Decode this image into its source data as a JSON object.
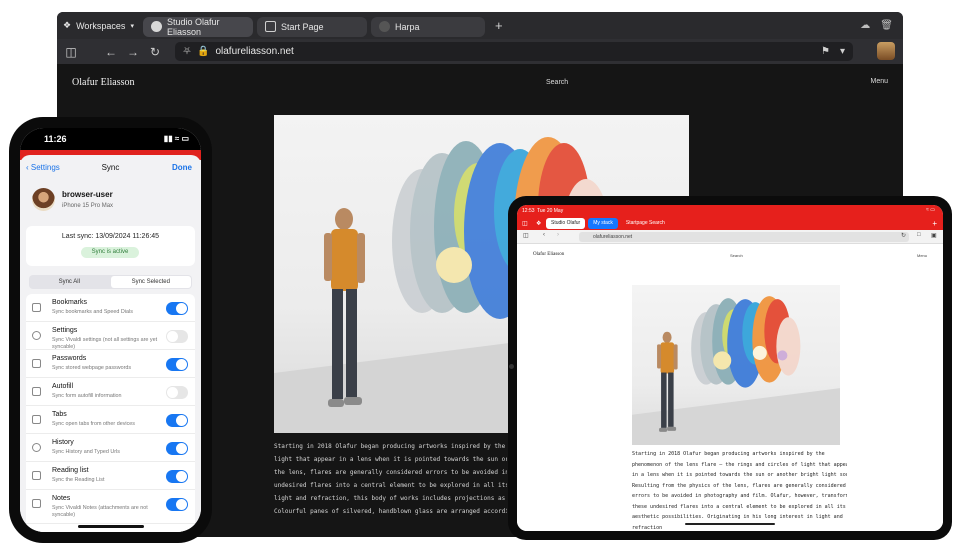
{
  "desktop": {
    "workspaces_label": "Workspaces",
    "tabs": [
      {
        "label": "Studio Olafur Eliasson"
      },
      {
        "label": "Start Page"
      },
      {
        "label": "Harpa"
      }
    ],
    "url": "olafureliasson.net",
    "site": {
      "logo": "Olafur Eliasson",
      "search": "Search",
      "menu": "Menu",
      "article_lines": [
        "Starting in 2018 Olafur began producing artworks inspired by the pho",
        "light that appear in a lens when it is pointed towards the sun or anot",
        "the lens, flares are generally considered errors to be avoided in phot",
        "undesired flares into a central element to be explored in all its aesth",
        "light and refraction, this body of works includes projections as well a",
        "Colourful panes of silvered, handblown glass are arranged according"
      ]
    }
  },
  "phone": {
    "time": "11:26",
    "back_label": "Settings",
    "title": "Sync",
    "done_label": "Done",
    "user_name": "browser-user",
    "device": "iPhone 15 Pro Max",
    "last_sync": "Last sync: 13/09/2024 11:26:45",
    "sync_status": "Sync is active",
    "segments": [
      "Sync All",
      "Sync Selected"
    ],
    "items": [
      {
        "label": "Bookmarks",
        "desc": "Sync bookmarks and Speed Dials",
        "on": true
      },
      {
        "label": "Settings",
        "desc": "Sync Vivaldi settings (not all settings are yet syncable)",
        "on": false
      },
      {
        "label": "Passwords",
        "desc": "Sync stored webpage passwords",
        "on": true
      },
      {
        "label": "Autofill",
        "desc": "Sync form autofill information",
        "on": false
      },
      {
        "label": "Tabs",
        "desc": "Sync open tabs from other devices",
        "on": true
      },
      {
        "label": "History",
        "desc": "Sync History and Typed Urls",
        "on": true
      },
      {
        "label": "Reading list",
        "desc": "Sync the Reading List",
        "on": true
      },
      {
        "label": "Notes",
        "desc": "Sync Vivaldi Notes (attachments are not syncable)",
        "on": true
      }
    ]
  },
  "tablet": {
    "time": "12:53",
    "date": "Tue 20 May",
    "tabs": [
      {
        "label": "Studio Olafur",
        "kind": "active"
      },
      {
        "label": "My stack",
        "kind": "stack"
      },
      {
        "label": "Startpage Search",
        "kind": "normal"
      }
    ],
    "url": "olafureliasson.net",
    "site": {
      "logo": "Olafur Eliasson",
      "search": "Search",
      "menu": "Menu",
      "article_lines": [
        "Starting in 2018 Olafur began producing artworks inspired by the",
        "phenomenon of the lens flare – the rings and circles of light that appear",
        "in a lens when it is pointed towards the sun or another bright light source.",
        "Resulting from the physics of the lens, flares are generally considered",
        "errors to be avoided in photography and film. Olafur, however, transforms",
        "these undesired flares into a central element to be explored in all its",
        "aesthetic possibilities. Originating in his long interest in light and",
        "refraction"
      ]
    }
  },
  "colors": {
    "vivaldi_red": "#e6201c",
    "toggle_on": "#1877f2",
    "active_green": "#2f7d3a"
  }
}
